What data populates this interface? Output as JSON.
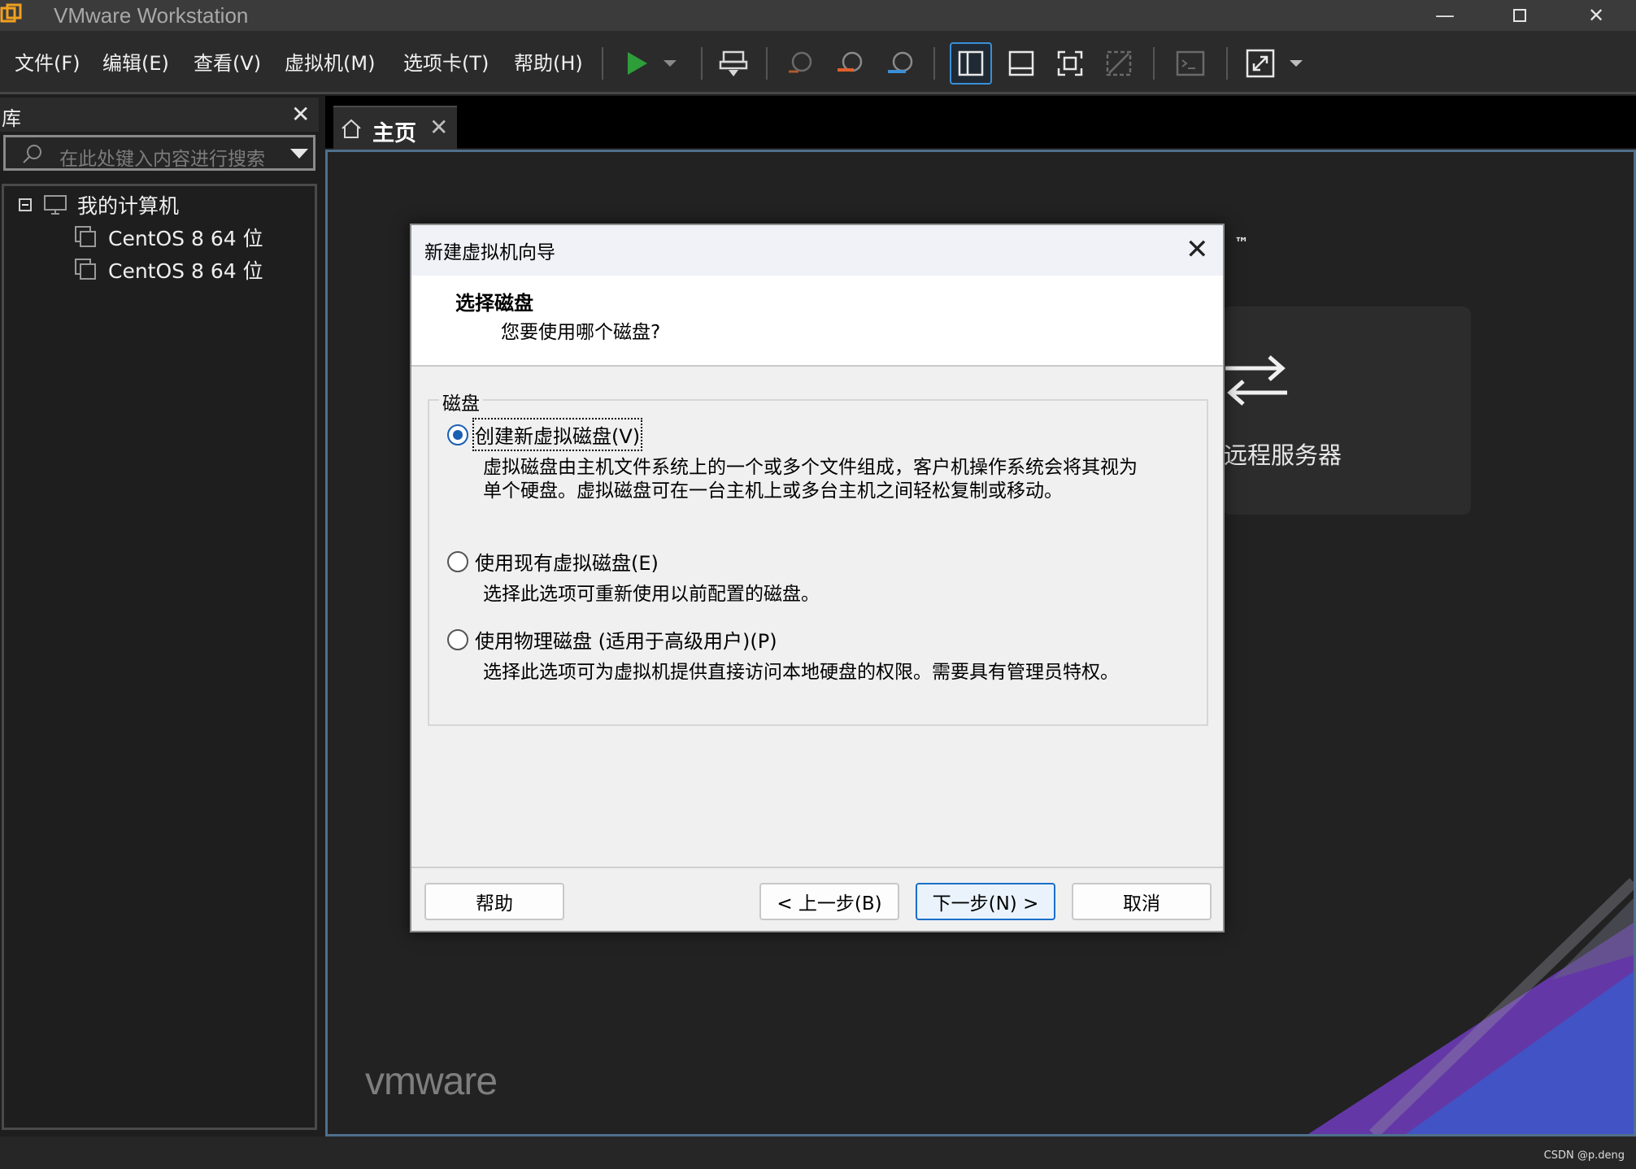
{
  "window": {
    "title": "VMware Workstation"
  },
  "menu": [
    "文件(F)",
    "编辑(E)",
    "查看(V)",
    "虚拟机(M)",
    "选项卡(T)",
    "帮助(H)"
  ],
  "library": {
    "title": "库",
    "search_placeholder": "在此处键入内容进行搜索",
    "root": "我的计算机",
    "vms": [
      "CentOS 8 64 位",
      "CentOS 8 64 位"
    ]
  },
  "tabs": {
    "home_label": "主页"
  },
  "home": {
    "remote_label": "远程服务器",
    "trademark": "™",
    "brand": "vmware"
  },
  "dialog": {
    "title": "新建虚拟机向导",
    "heading": "选择磁盘",
    "subheading": "您要使用哪个磁盘?",
    "group_label": "磁盘",
    "options": [
      {
        "label": "创建新虚拟磁盘(V)",
        "desc_line1": "虚拟磁盘由主机文件系统上的一个或多个文件组成，客户机操作系统会将其视为",
        "desc_line2": "单个硬盘。虚拟磁盘可在一台主机上或多台主机之间轻松复制或移动。",
        "selected": true
      },
      {
        "label": "使用现有虚拟磁盘(E)",
        "desc_line1": "选择此选项可重新使用以前配置的磁盘。",
        "selected": false
      },
      {
        "label": "使用物理磁盘 (适用于高级用户)(P)",
        "desc_line1": "选择此选项可为虚拟机提供直接访问本地硬盘的权限。需要具有管理员特权。",
        "selected": false
      }
    ],
    "buttons": {
      "help": "帮助",
      "back": "< 上一步(B)",
      "next": "下一步(N) >",
      "cancel": "取消"
    }
  },
  "watermark": "CSDN @p.deng",
  "colors": {
    "accent": "#1a6fc9",
    "play": "#2e9e3a",
    "panel": "#2b2b2b"
  }
}
